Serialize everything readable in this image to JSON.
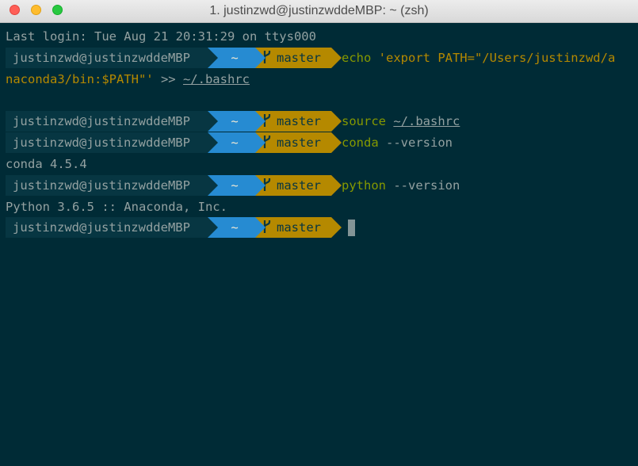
{
  "window": {
    "title": "1. justinzwd@justinzwddeMBP: ~ (zsh)"
  },
  "terminal": {
    "last_login": "Last login: Tue Aug 21 20:31:29 on ttys000",
    "prompt": {
      "user_host": "justinzwd@justinzwddeMBP",
      "dir": "~",
      "branch": "master"
    },
    "entries": [
      {
        "cmd": "echo",
        "arg_line1": " 'export PATH=\"/Users/justinzwd/a",
        "arg_line2": "naconda3/bin:$PATH\"'",
        "redirect": " >> ",
        "target": "~/.bashrc"
      },
      {
        "cmd": "source",
        "space": " ",
        "arg": "~/.bashrc"
      },
      {
        "cmd": "conda",
        "arg": " --version",
        "output": "conda 4.5.4"
      },
      {
        "cmd": "python",
        "arg": " --version",
        "output": "Python 3.6.5 :: Anaconda, Inc."
      }
    ]
  },
  "colors": {
    "background": "#002b36",
    "user_segment": "#073642",
    "dir_segment": "#268bd2",
    "git_segment": "#b58900",
    "command": "#859900"
  },
  "icons": {
    "branch": "git-branch-icon"
  }
}
